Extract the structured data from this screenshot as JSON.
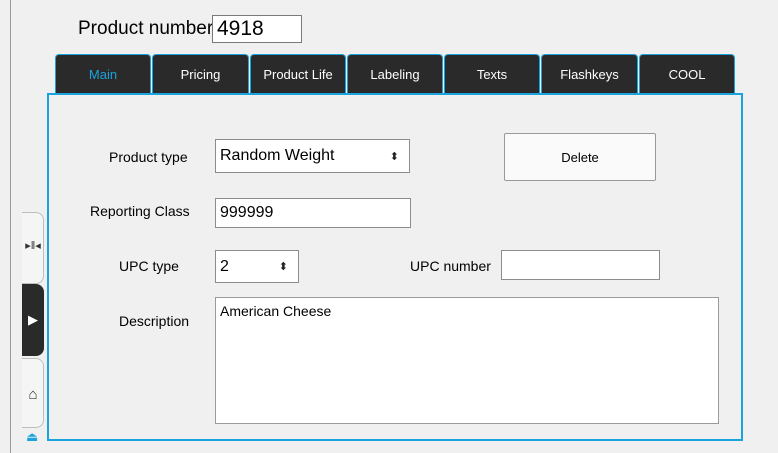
{
  "header": {
    "product_number_label": "Product number",
    "product_number_value": "4918"
  },
  "tabs": [
    {
      "label": "Main",
      "active": true
    },
    {
      "label": "Pricing",
      "active": false
    },
    {
      "label": "Product Life",
      "active": false
    },
    {
      "label": "Labeling",
      "active": false
    },
    {
      "label": "Texts",
      "active": false
    },
    {
      "label": "Flashkeys",
      "active": false
    },
    {
      "label": "COOL",
      "active": false
    }
  ],
  "form": {
    "product_type_label": "Product type",
    "product_type_value": "Random Weight",
    "delete_label": "Delete",
    "reporting_class_label": "Reporting Class",
    "reporting_class_value": "999999",
    "upc_type_label": "UPC type",
    "upc_type_value": "2",
    "upc_number_label": "UPC number",
    "upc_number_value": "",
    "description_label": "Description",
    "description_value": "American Cheese"
  },
  "side_toolbar": {
    "icons": [
      "collapse-icon",
      "play-icon",
      "home-icon",
      "eject-icon"
    ]
  },
  "colors": {
    "accent": "#1aa3dc",
    "tab_background": "#2a2a2a",
    "background": "#f0f0f0"
  }
}
